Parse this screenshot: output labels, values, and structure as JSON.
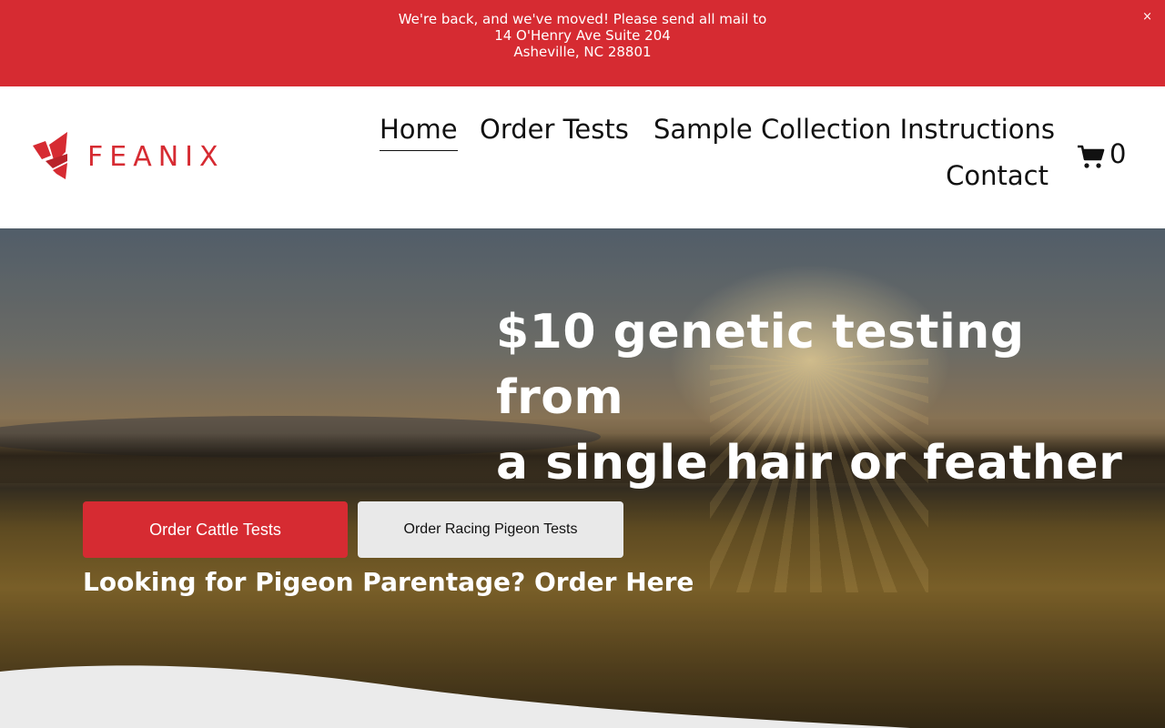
{
  "announcement": {
    "lines": [
      "We're back, and we've moved! Please send all mail to",
      "14 O'Henry Ave Suite 204",
      "Asheville, NC 28801"
    ],
    "close_label": "×",
    "background_color": "#d62b32"
  },
  "header": {
    "logo_text": "FEANIX",
    "nav": {
      "home": "Home",
      "order_tests": "Order Tests",
      "sample_instructions": "Sample Collection Instructions",
      "contact": "Contact"
    },
    "cart_count": "0",
    "cart_icon": "cart-icon"
  },
  "hero": {
    "headline_line1": "$10 genetic testing from",
    "headline_line2": "a single hair or feather",
    "buttons": {
      "cattle": "Order Cattle Tests",
      "pigeon": "Order Racing Pigeon Tests"
    },
    "parentage_link": "Looking for Pigeon Parentage? Order Here",
    "accent_color": "#d62b32"
  }
}
